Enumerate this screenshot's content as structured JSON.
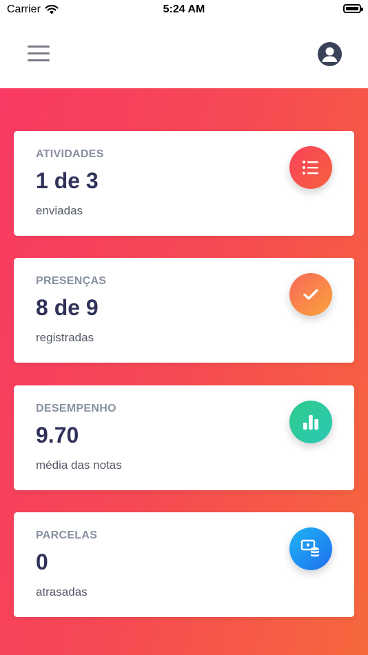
{
  "status_bar": {
    "carrier": "Carrier",
    "time": "5:24 AM"
  },
  "colors": {
    "gradient_start": "#f93a64",
    "gradient_end": "#f6683c",
    "card_title": "#8790a0",
    "card_value": "#30325a",
    "card_caption": "#555a68"
  },
  "cards": [
    {
      "title": "ATIVIDADES",
      "value": "1 de 3",
      "caption": "enviadas",
      "icon": "list-icon",
      "icon_gradient": [
        "#f8425a",
        "#f6613f"
      ]
    },
    {
      "title": "PRESENÇAS",
      "value": "8 de 9",
      "caption": "registradas",
      "icon": "check-icon",
      "icon_gradient": [
        "#f7685a",
        "#fba33a"
      ]
    },
    {
      "title": "DESEMPENHO",
      "value": "9.70",
      "caption": "média das notas",
      "icon": "bar-chart-icon",
      "icon_gradient": [
        "#2fcb8c",
        "#2bc8b4"
      ]
    },
    {
      "title": "PARCELAS",
      "value": "0",
      "caption": "atrasadas",
      "icon": "payment-icon",
      "icon_gradient": [
        "#1fb5f3",
        "#1f6ef0"
      ]
    }
  ]
}
